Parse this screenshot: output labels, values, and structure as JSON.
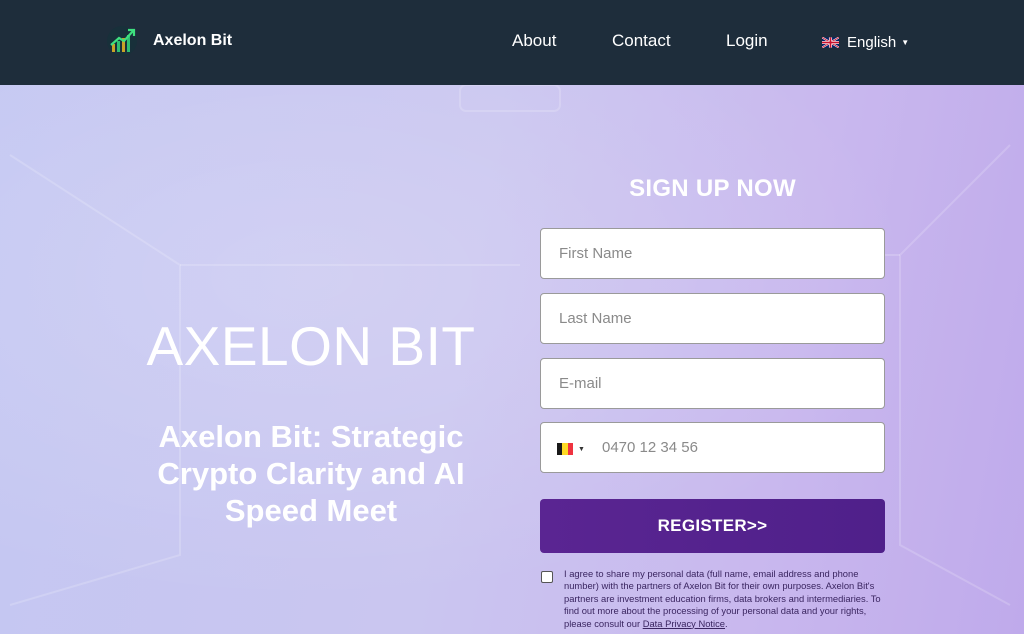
{
  "header": {
    "brand": "Axelon Bit",
    "nav": {
      "about": "About",
      "contact": "Contact",
      "login": "Login"
    },
    "language": "English"
  },
  "hero": {
    "title": "AXELON BIT",
    "subtitle": "Axelon Bit: Strategic Crypto Clarity and AI Speed Meet"
  },
  "form": {
    "title": "SIGN UP NOW",
    "first_name_placeholder": "First Name",
    "last_name_placeholder": "Last Name",
    "email_placeholder": "E-mail",
    "phone_placeholder": "0470 12 34 56",
    "register_label": "REGISTER>>",
    "consent_text": "I agree to share my personal data (full name, email address and phone number) with the partners of Axelon Bit for their own purposes. Axelon Bit's partners are investment education firms, data brokers and intermediaries. To find out more about the processing of your personal data and your rights, please consult our ",
    "privacy_link": "Data Privacy Notice",
    "consent_end": "."
  },
  "colors": {
    "header_bg": "#1e2d3b",
    "register_button": "#55238f",
    "hero_gradient_start": "#c4c7f2",
    "hero_gradient_end": "#bfaaeb"
  },
  "icons": {
    "logo": "chart-rising-arrow-icon",
    "language_flag": "uk-flag-icon",
    "country_flag": "belgium-flag-icon"
  }
}
